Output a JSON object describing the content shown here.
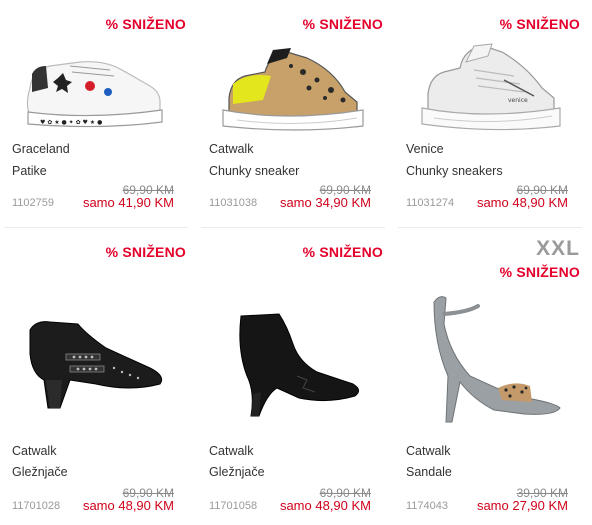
{
  "badge_label": "% SNIŽENO",
  "colors": {
    "sale": "#e4002b",
    "price": "#d0021b",
    "muted": "#9a9a9a"
  },
  "products": [
    {
      "brand": "Graceland",
      "type": "Patike",
      "sku": "1102759",
      "old_price": "69,90 KM",
      "new_price": "samo 41,90 KM",
      "image": "white-sneaker-icon"
    },
    {
      "brand": "Catwalk",
      "type": "Chunky sneaker",
      "sku": "11031038",
      "old_price": "69,90 KM",
      "new_price": "samo 34,90 KM",
      "image": "leopard-chunky-sneaker-icon"
    },
    {
      "brand": "Venice",
      "type": "Chunky sneakers",
      "sku": "11031274",
      "old_price": "69,90 KM",
      "new_price": "samo 48,90 KM",
      "image": "white-chunky-sneaker-icon"
    },
    {
      "brand": "Catwalk",
      "type": "Gležnjače",
      "sku": "11701028",
      "old_price": "69,90 KM",
      "new_price": "samo 48,90 KM",
      "image": "studded-bootie-icon"
    },
    {
      "brand": "Catwalk",
      "type": "Gležnjače",
      "sku": "11701058",
      "old_price": "69,90 KM",
      "new_price": "samo 48,90 KM",
      "image": "suede-heel-bootie-icon"
    },
    {
      "brand": "Catwalk",
      "type": "Sandale",
      "sku": "1174043",
      "old_price": "39,90 KM",
      "new_price": "samo 27,90 KM",
      "image": "strappy-sandal-icon",
      "size_tag": "XXL"
    }
  ]
}
